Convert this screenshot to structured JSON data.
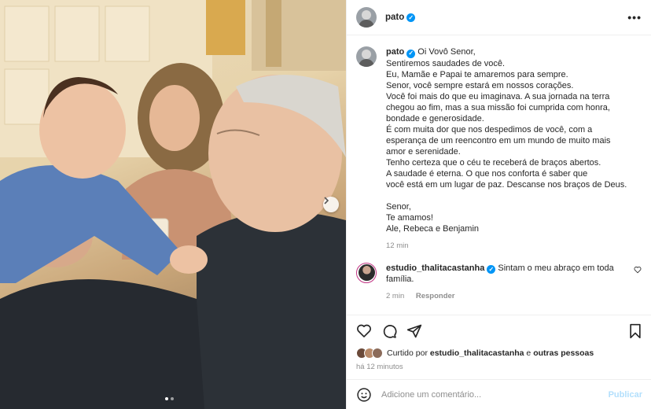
{
  "post": {
    "author": "pato",
    "caption_lines": [
      "Oi Vovô Senor,",
      "Sentiremos saudades de você.",
      "Eu, Mamãe e Papai te amaremos para sempre.",
      "Senor, você sempre estará em nossos corações.",
      "Você foi mais do que eu imaginava. A sua jornada na terra",
      "chegou ao fim, mas a sua missão foi cumprida com honra,",
      "bondade e generosidade.",
      "É com muita dor que nos despedimos de você, com a",
      "esperança de um reencontro em um mundo de muito mais",
      "amor e serenidade.",
      "Tenho certeza que o céu te receberá de braços abertos.",
      "A saudade é eterna. O que nos conforta é saber que",
      "você está em um lugar de paz. Descanse nos braços de Deus.",
      "",
      "Senor,",
      "Te amamos!",
      "Ale, Rebeca e Benjamin"
    ],
    "caption_time": "12 min"
  },
  "comment": {
    "author": "estudio_thalitacastanha",
    "text": "Sintam o meu abraço em toda família.",
    "time": "2 min",
    "reply_label": "Responder"
  },
  "likes": {
    "prefix": "Curtido por",
    "user": "estudio_thalitacastanha",
    "conj": "e",
    "others": "outras pessoas"
  },
  "post_time": "há 12 minutos",
  "composer": {
    "placeholder": "Adicione um comentário...",
    "publish_label": "Publicar"
  },
  "colors": {
    "verified": "#0095f6",
    "publish_disabled": "#b2dffc",
    "muted": "#8e8e8e"
  }
}
